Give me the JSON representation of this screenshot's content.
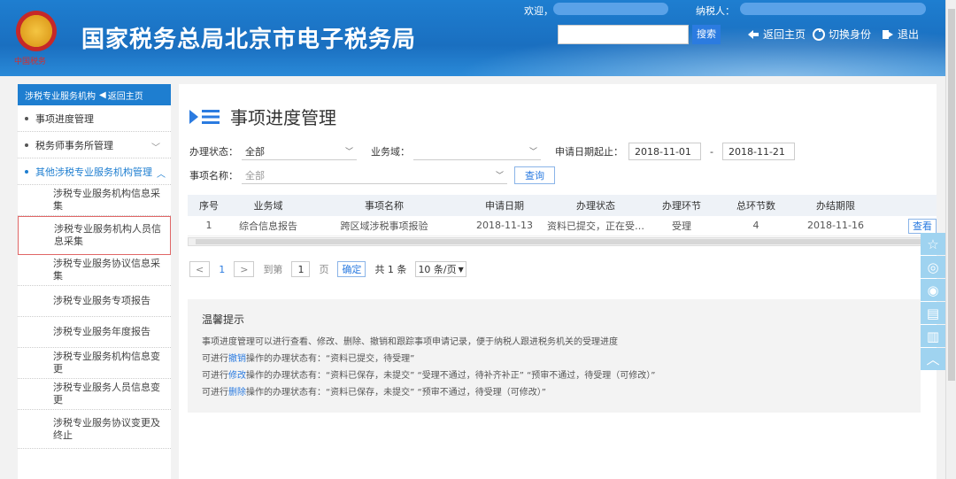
{
  "header": {
    "site_title": "国家税务总局北京市电子税务局",
    "emblem_text": "中国税务",
    "welcome": "欢迎，",
    "taxpayer": "纳税人：",
    "search_btn": "搜索",
    "back_home": "返回主页",
    "switch_identity": "切换身份",
    "logout": "退出"
  },
  "sidebar": {
    "head": "涉税专业服务机构",
    "head_back": "返回主页",
    "items": [
      {
        "label": "事项进度管理"
      },
      {
        "label": "税务师事务所管理"
      },
      {
        "label": "其他涉税专业服务机构管理"
      }
    ],
    "subitems": [
      "涉税专业服务机构信息采集",
      "涉税专业服务机构人员信息采集",
      "涉税专业服务协议信息采集",
      "涉税专业服务专项报告",
      "涉税专业服务年度报告",
      "涉税专业服务机构信息变更",
      "涉税专业服务人员信息变更",
      "涉税专业服务协议变更及终止"
    ]
  },
  "main": {
    "title": "事项进度管理",
    "filters": {
      "status_label": "办理状态：",
      "status_value": "全部",
      "domain_label": "业务域：",
      "domain_value": "",
      "date_from_label": "申请日期起止：",
      "date_from": "2018-11-01",
      "date_sep": "-",
      "date_to": "2018-11-21",
      "item_label": "事项名称：",
      "item_placeholder": "全部",
      "query_btn": "查询"
    },
    "table": {
      "headers": [
        "序号",
        "业务域",
        "事项名称",
        "申请日期",
        "办理状态",
        "办理环节",
        "总环节数",
        "办结期限",
        ""
      ],
      "rows": [
        [
          "1",
          "综合信息报告",
          "跨区域涉税事项报验",
          "2018-11-13",
          "资料已提交，正在受…",
          "受理",
          "4",
          "2018-11-16",
          "查看"
        ]
      ]
    },
    "pager": {
      "current": "1",
      "goto_label": "到第",
      "goto_value": "1",
      "page_unit": "页",
      "confirm": "确定",
      "total": "共 1 条",
      "page_size": "10 条/页"
    },
    "tips": {
      "title": "温馨提示",
      "line1": "事项进度管理可以进行查看、修改、删除、撤销和跟踪事项申请记录，便于纳税人跟进税务机关的受理进度",
      "line2_pre": "可进行",
      "line2_link": "撤销",
      "line2_post": "操作的办理状态有：“资料已提交，待受理”",
      "line3_pre": "可进行",
      "line3_link": "修改",
      "line3_post": "操作的办理状态有：“资料已保存，未提交”  “受理不通过，待补齐补正”  “预审不通过，待受理（可修改）”",
      "line4_pre": "可进行",
      "line4_link": "删除",
      "line4_post": "操作的办理状态有：“资料已保存，未提交”  “预审不通过，待受理（可修改）”"
    }
  },
  "floatbar": [
    "star-icon",
    "wechat-icon",
    "weibo-icon",
    "message-icon",
    "clipboard-icon",
    "arrow-up-icon"
  ]
}
